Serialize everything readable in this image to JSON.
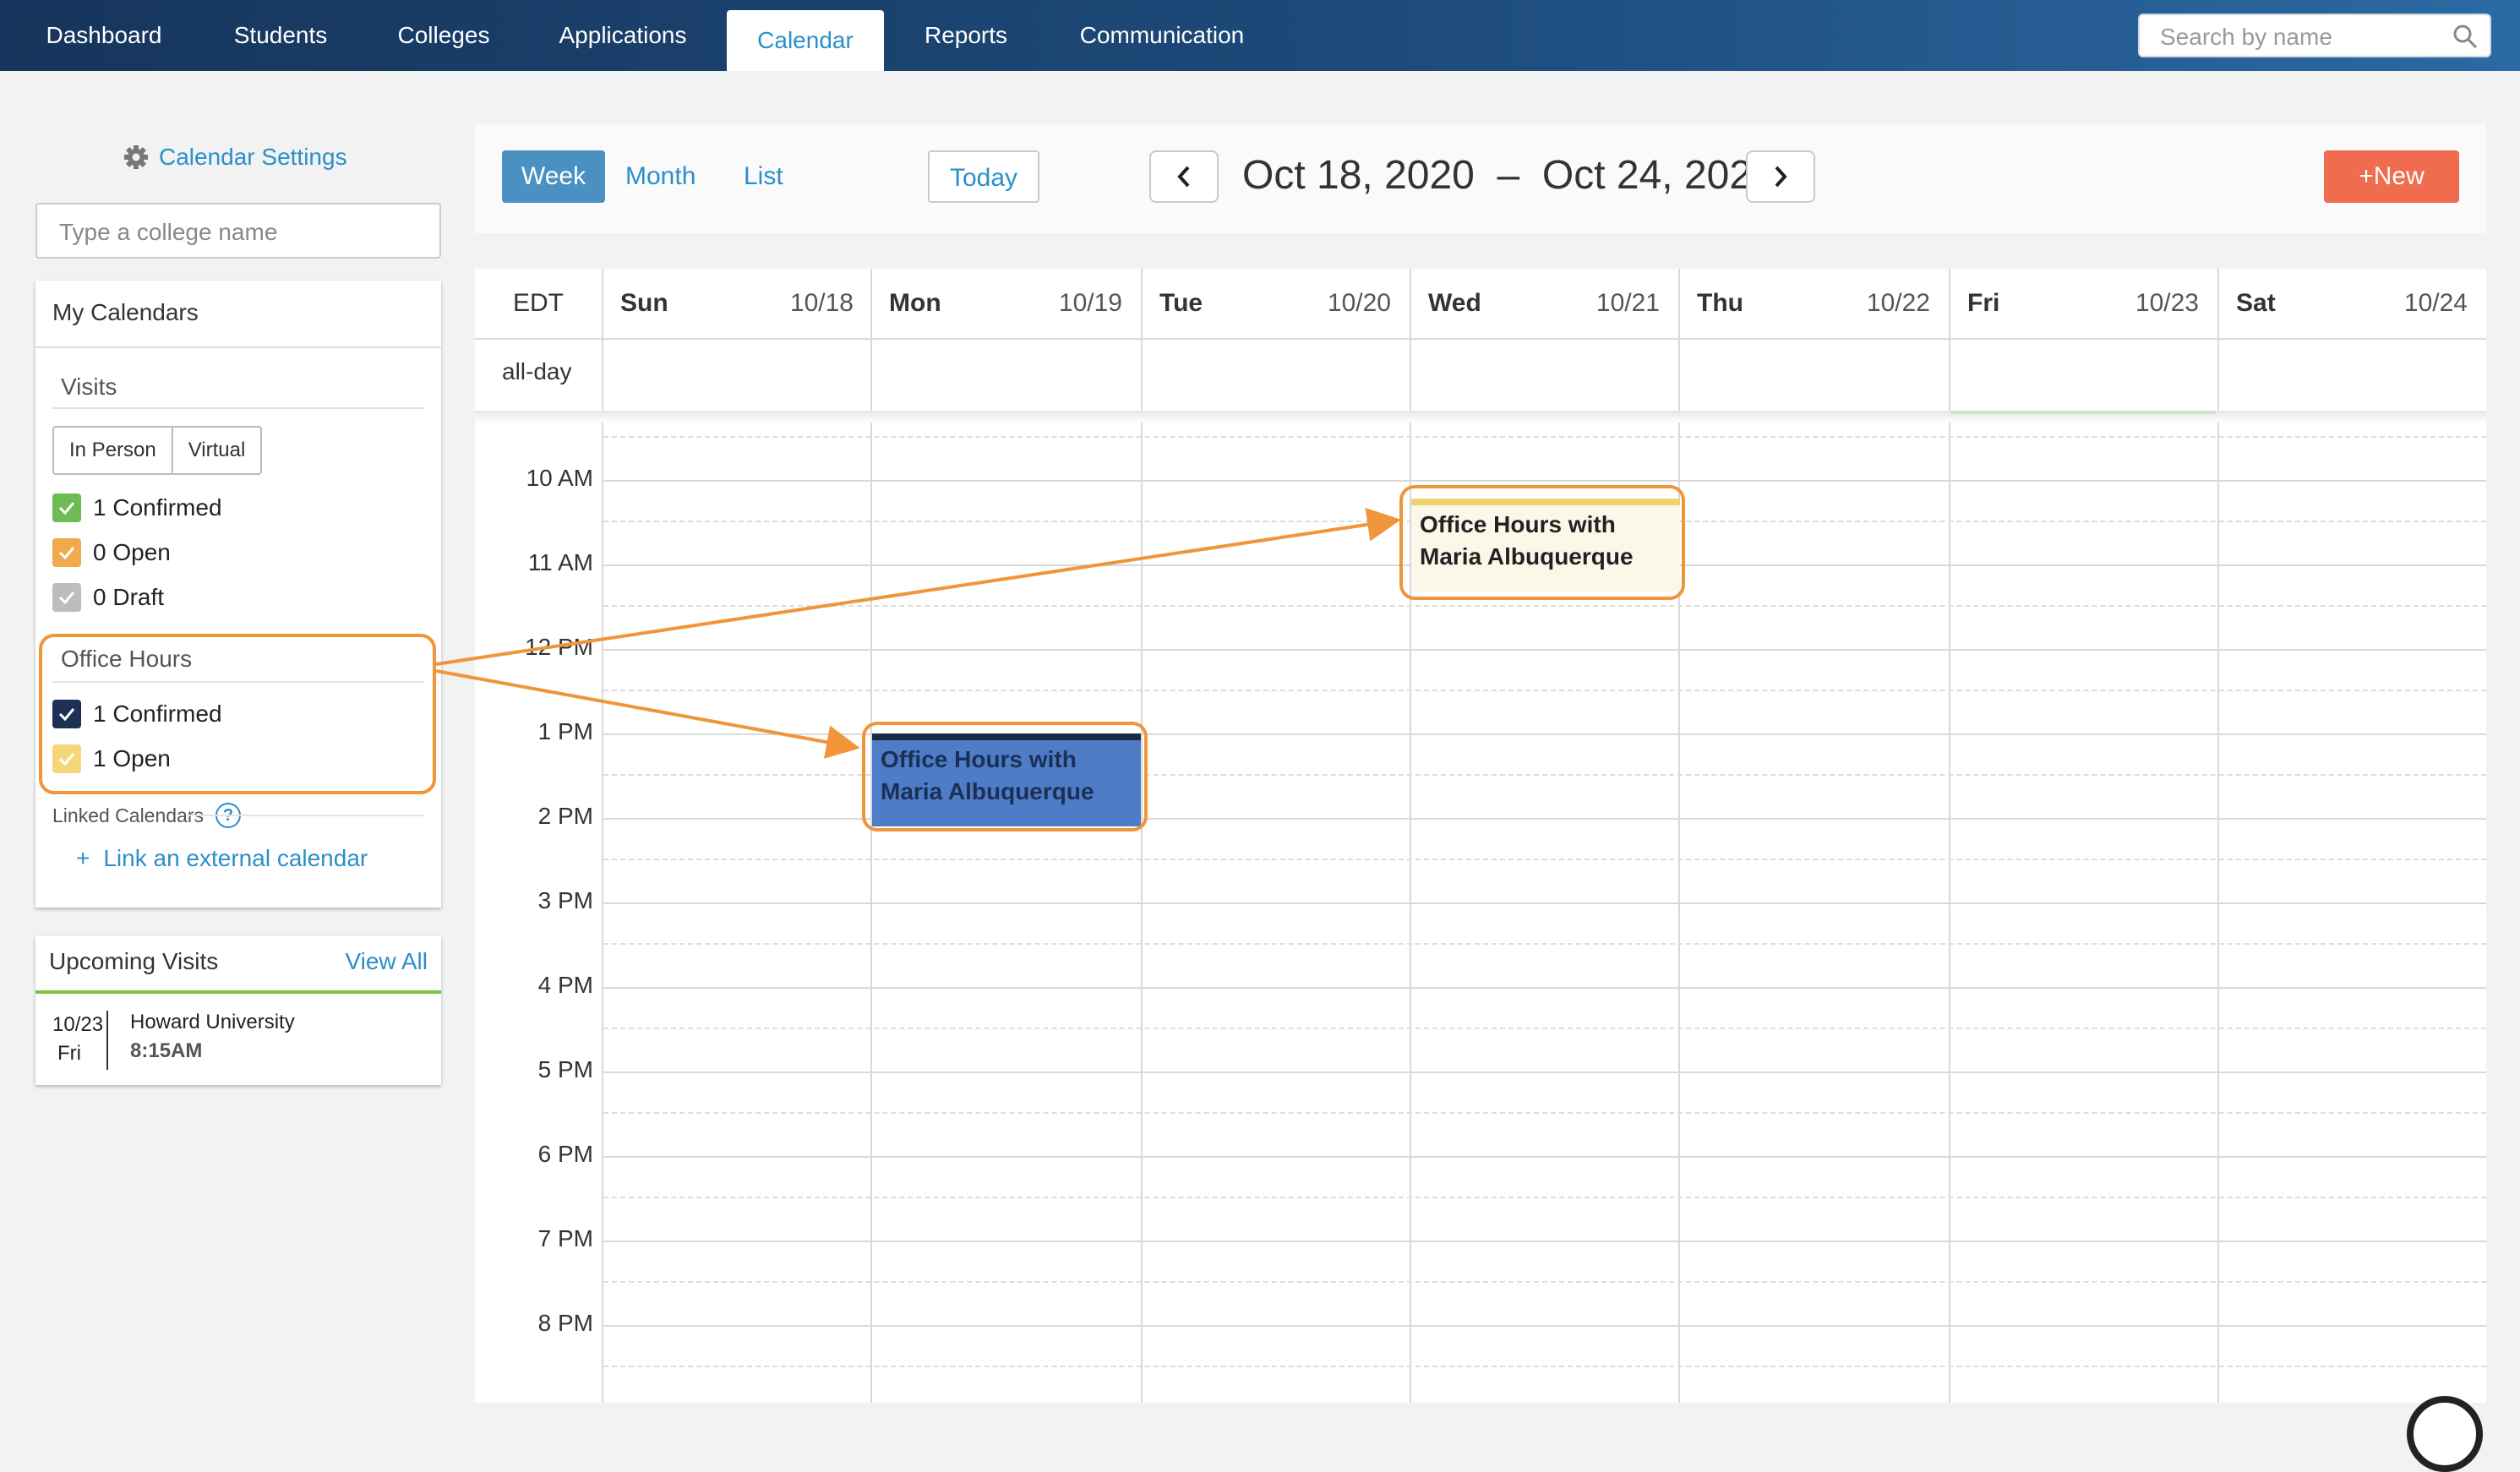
{
  "nav": {
    "tabs": [
      {
        "label": "Dashboard"
      },
      {
        "label": "Students"
      },
      {
        "label": "Colleges"
      },
      {
        "label": "Applications"
      },
      {
        "label": "Calendar"
      },
      {
        "label": "Reports"
      },
      {
        "label": "Communication"
      }
    ],
    "search_placeholder": "Search by name"
  },
  "sidebar": {
    "settings_label": "Calendar Settings",
    "college_placeholder": "Type a college name",
    "my_calendars": {
      "title": "My Calendars",
      "visits_label": "Visits",
      "visit_modes": [
        "In Person",
        "Virtual"
      ],
      "visits": [
        {
          "label": "1 Confirmed",
          "color": "#6dbb55"
        },
        {
          "label": "0 Open",
          "color": "#f0a94d"
        },
        {
          "label": "0 Draft",
          "color": "#bdbdbd"
        }
      ],
      "office_hours_label": "Office Hours",
      "office_hours": [
        {
          "label": "1 Confirmed",
          "color": "#1c2f55"
        },
        {
          "label": "1 Open",
          "color": "#f5d77a"
        }
      ],
      "linked_label": "Linked Calendars",
      "link_external": "Link an external calendar",
      "link_plus": "+"
    },
    "upcoming": {
      "title": "Upcoming Visits",
      "view_all": "View All",
      "items": [
        {
          "date": "10/23",
          "day": "Fri",
          "school": "Howard University",
          "time": "8:15AM"
        }
      ]
    }
  },
  "toolbar": {
    "views": [
      "Week",
      "Month",
      "List"
    ],
    "active_view": "Week",
    "today": "Today",
    "range": "Oct 18, 2020  –  Oct 24, 2020",
    "new_label": "New",
    "new_plus": "+"
  },
  "calendar": {
    "timezone": "EDT",
    "allday_label": "all-day",
    "days": [
      {
        "name": "Sun",
        "date": "10/18"
      },
      {
        "name": "Mon",
        "date": "10/19"
      },
      {
        "name": "Tue",
        "date": "10/20"
      },
      {
        "name": "Wed",
        "date": "10/21"
      },
      {
        "name": "Thu",
        "date": "10/22"
      },
      {
        "name": "Fri",
        "date": "10/23"
      },
      {
        "name": "Sat",
        "date": "10/24"
      }
    ],
    "hours": [
      "10 AM",
      "11 AM",
      "12 PM",
      "1 PM",
      "2 PM",
      "3 PM",
      "4 PM",
      "5 PM",
      "6 PM",
      "7 PM",
      "8 PM"
    ],
    "events": [
      {
        "title": "Office Hours with Maria Albuquerque",
        "day": "Wed",
        "status": "Open"
      },
      {
        "title": "Office Hours with Maria Albuquerque",
        "day": "Mon",
        "status": "Confirmed"
      }
    ]
  },
  "colors": {
    "nav_bg": "#1d4a7a",
    "accent": "#2b8fc9",
    "highlight": "#f0953a",
    "new_button": "#ef6c4e"
  }
}
